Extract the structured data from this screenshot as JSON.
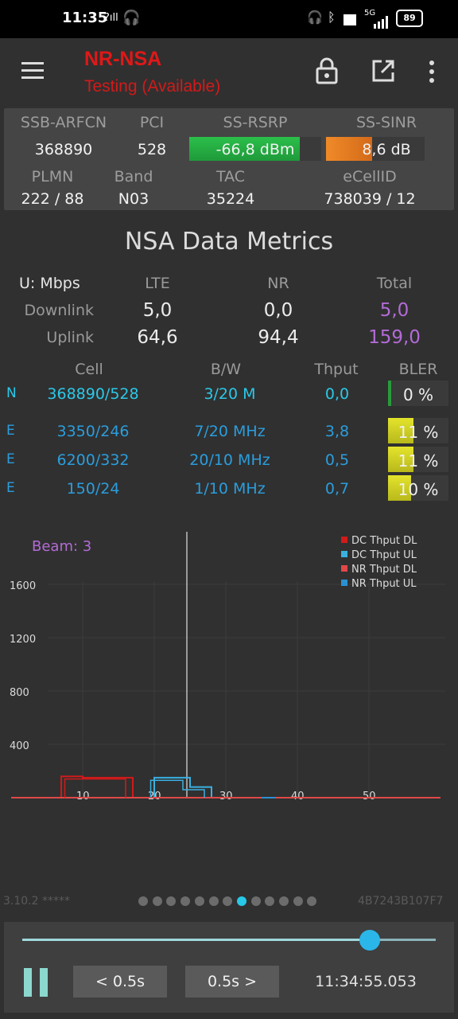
{
  "status": {
    "time": "11:35",
    "network_small": "?ıll",
    "battery": "89",
    "net_type": "5G"
  },
  "app": {
    "title": "NR-NSA",
    "subtitle": "Testing (Available)"
  },
  "cell": {
    "headers": [
      "SSB-ARFCN",
      "PCI",
      "SS-RSRP",
      "SS-SINR"
    ],
    "arfcn": "368890",
    "pci": "528",
    "rsrp": "-66,8 dBm",
    "rsrp_level": 0.84,
    "sinr": "8,6 dB",
    "sinr_level": 0.47,
    "headers2": [
      "PLMN",
      "Band",
      "TAC",
      "eCellID"
    ],
    "plmn": "222 / 88",
    "band": "N03",
    "tac": "35224",
    "ecellid": "738039 / 12"
  },
  "metrics": {
    "title": "NSA Data Metrics",
    "unit": "U: Mbps",
    "cols": [
      "LTE",
      "NR",
      "Total"
    ],
    "downlink_label": "Downlink",
    "uplink_label": "Uplink",
    "dl": [
      "5,0",
      "0,0",
      "5,0"
    ],
    "ul": [
      "64,6",
      "94,4",
      "159,0"
    ]
  },
  "cells_table": {
    "headers": [
      "Cell",
      "B/W",
      "Thput",
      "BLER"
    ],
    "rows": [
      {
        "type": "N",
        "cell": "368890/528",
        "bw": "3/20 M",
        "thput": "0,0",
        "bler": "0 %",
        "bler_level": 0.0
      },
      {
        "type": "E",
        "cell": "3350/246",
        "bw": "7/20 MHz",
        "thput": "3,8",
        "bler": "11 %",
        "bler_level": 0.11
      },
      {
        "type": "E",
        "cell": "6200/332",
        "bw": "20/10 MHz",
        "thput": "0,5",
        "bler": "11 %",
        "bler_level": 0.11
      },
      {
        "type": "E",
        "cell": "150/24",
        "bw": "1/10 MHz",
        "thput": "0,7",
        "bler": "10 %",
        "bler_level": 0.1
      }
    ]
  },
  "chart_data": {
    "type": "line",
    "annotation": "Beam: 3",
    "x_ticks": [
      "10",
      "20",
      "30",
      "40",
      "50"
    ],
    "y_ticks": [
      "400",
      "800",
      "1200",
      "1600"
    ],
    "xlim": [
      0,
      60
    ],
    "ylim": [
      0,
      1600
    ],
    "legend_position": "top-right",
    "series": [
      {
        "name": "DC Thput DL",
        "color": "#d11a1a",
        "x": [
          6,
          7,
          7,
          10,
          10,
          17,
          17,
          19
        ],
        "y": [
          0,
          0,
          160,
          160,
          150,
          150,
          0,
          0
        ]
      },
      {
        "name": "DC Thput UL",
        "color": "#3ab0e0",
        "x": [
          19,
          20,
          20,
          25,
          25,
          28,
          28,
          33
        ],
        "y": [
          0,
          0,
          150,
          150,
          80,
          80,
          0,
          0
        ]
      },
      {
        "name": "NR Thput DL",
        "color": "#e04848",
        "x": [
          0,
          60
        ],
        "y": [
          0,
          0
        ]
      },
      {
        "name": "NR Thput UL",
        "color": "#2b90d0",
        "x": [
          35,
          37
        ],
        "y": [
          0,
          0
        ]
      }
    ]
  },
  "footer": {
    "version": "3.10.2 *****",
    "device_id": "4B7243B107F7",
    "dots": 13,
    "active_dot": 7
  },
  "player": {
    "back": "< 0.5s",
    "fwd": "0.5s >",
    "timestamp": "11:34:55.053",
    "position": 0.84
  }
}
